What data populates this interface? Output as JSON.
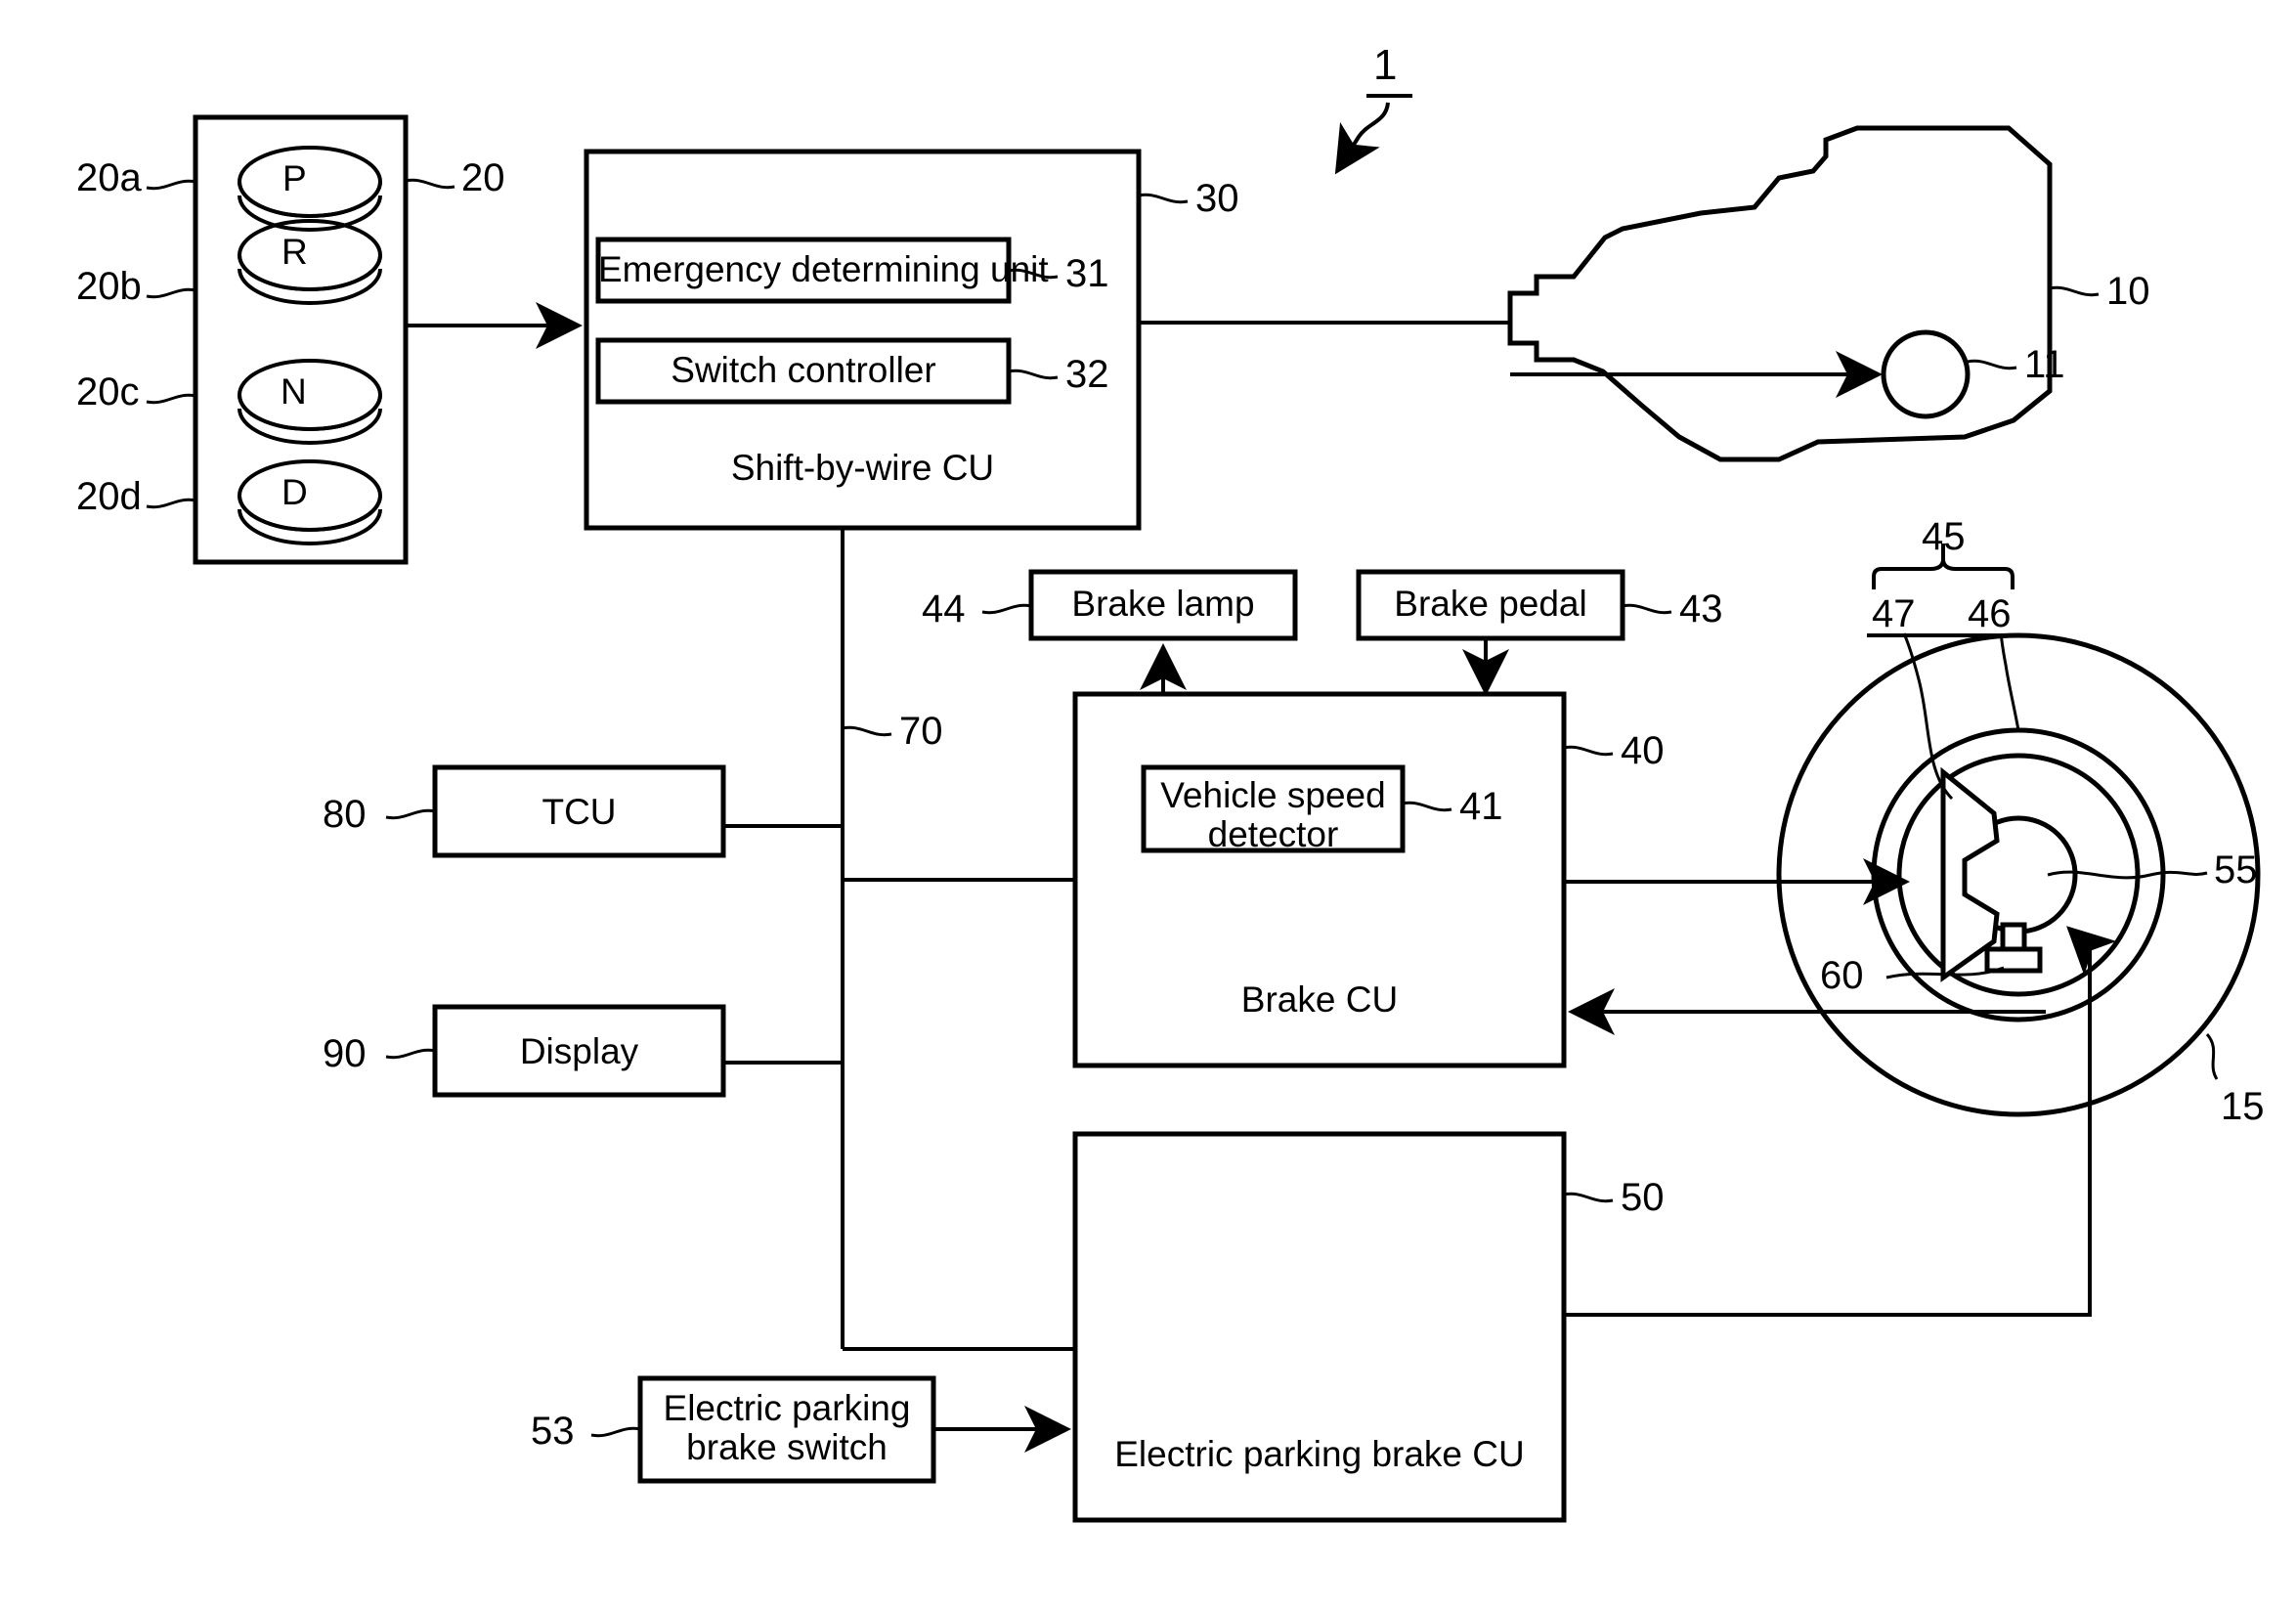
{
  "figure": {
    "number": "1",
    "title_reference": "1"
  },
  "shift_selector": {
    "ref": "20",
    "buttons": [
      {
        "label": "P",
        "ref": "20a"
      },
      {
        "label": "R",
        "ref": "20b"
      },
      {
        "label": "N",
        "ref": "20c"
      },
      {
        "label": "D",
        "ref": "20d"
      }
    ]
  },
  "shift_by_wire_cu": {
    "ref": "30",
    "title": "Shift-by-wire CU",
    "units": [
      {
        "label": "Emergency determining unit",
        "ref": "31"
      },
      {
        "label": "Switch controller",
        "ref": "32"
      }
    ]
  },
  "transmission": {
    "ref": "10",
    "actuator_ref": "11"
  },
  "brake_lamp": {
    "label": "Brake lamp",
    "ref": "44"
  },
  "brake_pedal": {
    "label": "Brake pedal",
    "ref": "43"
  },
  "brake_cu": {
    "ref": "40",
    "title": "Brake CU",
    "units": [
      {
        "label": "Vehicle speed detector",
        "line1": "Vehicle speed",
        "line2": "detector",
        "ref": "41"
      }
    ]
  },
  "tcu": {
    "label": "TCU",
    "ref": "80"
  },
  "display": {
    "label": "Display",
    "ref": "90"
  },
  "communication_bus": {
    "ref": "70"
  },
  "electric_parking_brake_cu": {
    "label": "Electric parking brake CU",
    "ref": "50"
  },
  "electric_parking_brake_switch": {
    "label": "Electric parking brake switch",
    "line1": "Electric parking",
    "line2": "brake switch",
    "ref": "53"
  },
  "wheel_assembly": {
    "wheel_ref": "15",
    "brake_unit_ref": "45",
    "rotor_ref": "47",
    "caliper_ref": "46",
    "hub_ref": "55",
    "parking_actuator_ref": "60"
  },
  "colors": {
    "line": "#000000",
    "background": "#ffffff"
  }
}
